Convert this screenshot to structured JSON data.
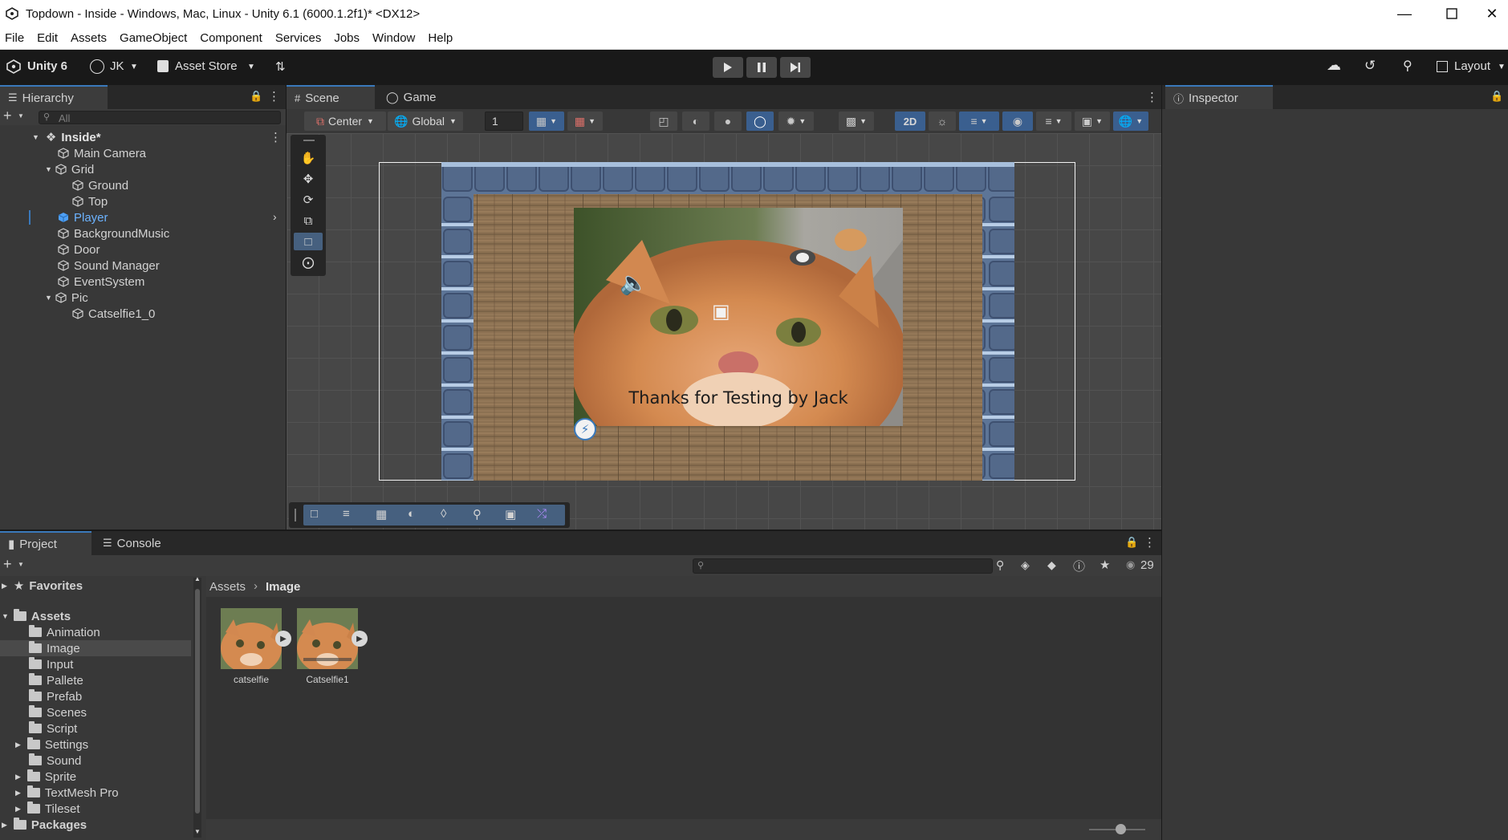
{
  "window": {
    "title": "Topdown - Inside - Windows, Mac, Linux - Unity 6.1 (6000.1.2f1)* <DX12>"
  },
  "menu": [
    "File",
    "Edit",
    "Assets",
    "GameObject",
    "Component",
    "Services",
    "Jobs",
    "Window",
    "Help"
  ],
  "toolbar": {
    "unity_label": "Unity 6",
    "account_label": "JK",
    "asset_store_label": "Asset Store",
    "layout_label": "Layout"
  },
  "hierarchy": {
    "tab_label": "Hierarchy",
    "search_placeholder": "All",
    "scene_name": "Inside*",
    "items": [
      {
        "label": "Main Camera"
      },
      {
        "label": "Grid"
      },
      {
        "label": "Ground"
      },
      {
        "label": "Top"
      },
      {
        "label": "Player"
      },
      {
        "label": "BackgroundMusic"
      },
      {
        "label": "Door"
      },
      {
        "label": "Sound Manager"
      },
      {
        "label": "EventSystem"
      },
      {
        "label": "Pic"
      },
      {
        "label": "Catselfie1_0"
      }
    ]
  },
  "scene": {
    "tabs": [
      "Scene",
      "Game"
    ],
    "pivot_label": "Center",
    "space_label": "Global",
    "grid_value": "1",
    "mode_2d_label": "2D",
    "overlay_text": "Thanks for Testing by Jack"
  },
  "inspector": {
    "tab_label": "Inspector"
  },
  "project": {
    "tabs": [
      "Project",
      "Console"
    ],
    "favorites_label": "Favorites",
    "assets_label": "Assets",
    "packages_label": "Packages",
    "folders": [
      {
        "label": "Animation",
        "expandable": false
      },
      {
        "label": "Image",
        "expandable": false
      },
      {
        "label": "Input",
        "expandable": false
      },
      {
        "label": "Pallete",
        "expandable": false
      },
      {
        "label": "Prefab",
        "expandable": false
      },
      {
        "label": "Scenes",
        "expandable": false
      },
      {
        "label": "Script",
        "expandable": false
      },
      {
        "label": "Settings",
        "expandable": true
      },
      {
        "label": "Sound",
        "expandable": false
      },
      {
        "label": "Sprite",
        "expandable": true
      },
      {
        "label": "TextMesh Pro",
        "expandable": true
      },
      {
        "label": "Tileset",
        "expandable": true
      }
    ],
    "breadcrumb": [
      "Assets",
      "Image"
    ],
    "assets": [
      {
        "label": "catselfie"
      },
      {
        "label": "Catselfie1"
      }
    ],
    "hidden_count": "29"
  },
  "colors": {
    "accent": "#3a79bb",
    "selected_text": "#4d9ff5",
    "panel": "#383838",
    "tabbar": "#282828"
  }
}
